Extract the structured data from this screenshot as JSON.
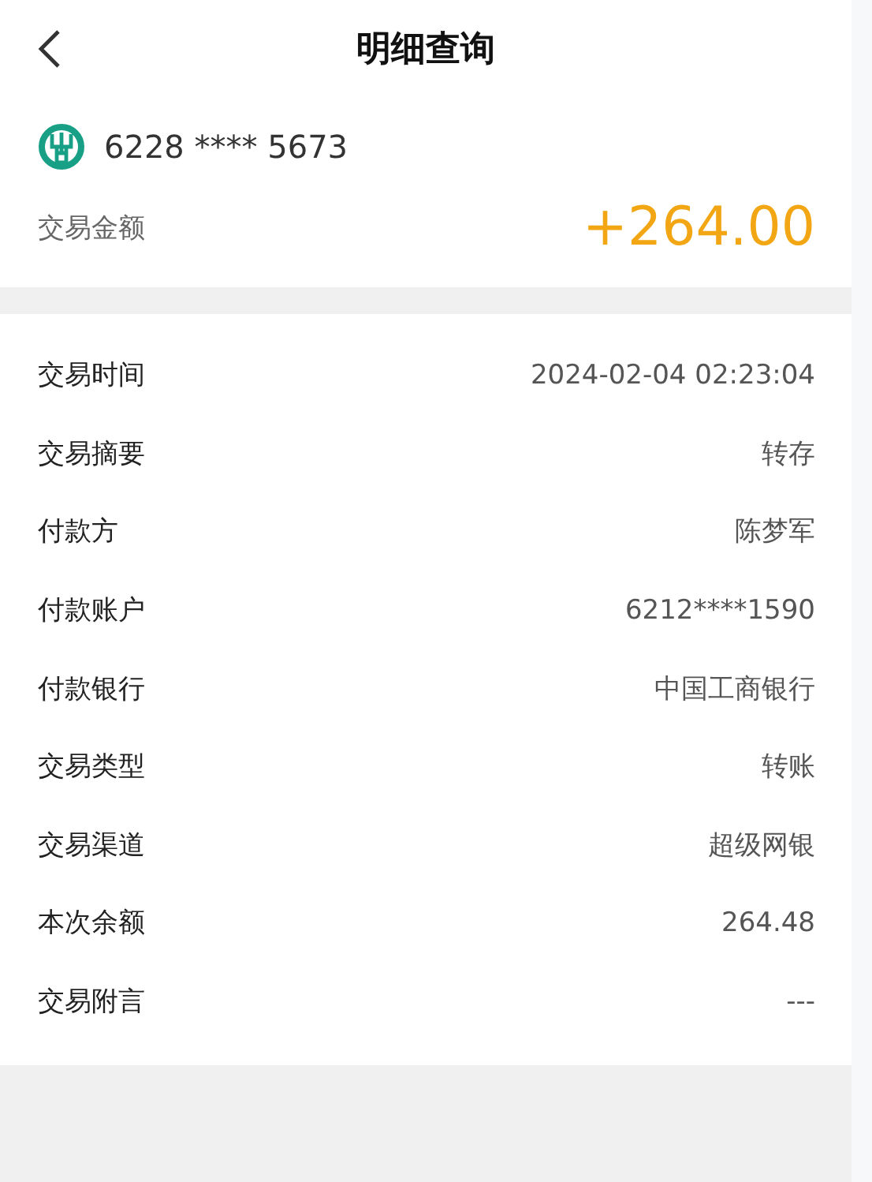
{
  "header": {
    "title": "明细查询"
  },
  "account": {
    "number": "6228 **** 5673",
    "amount_label": "交易金额",
    "amount": "+264.00"
  },
  "details": [
    {
      "label": "交易时间",
      "value": "2024-02-04 02:23:04"
    },
    {
      "label": "交易摘要",
      "value": "转存"
    },
    {
      "label": "付款方",
      "value": "陈梦军"
    },
    {
      "label": "付款账户",
      "value": "6212****1590"
    },
    {
      "label": "付款银行",
      "value": "中国工商银行"
    },
    {
      "label": "交易类型",
      "value": "转账"
    },
    {
      "label": "交易渠道",
      "value": "超级网银"
    },
    {
      "label": "本次余额",
      "value": "264.48"
    },
    {
      "label": "交易附言",
      "value": "---"
    }
  ]
}
